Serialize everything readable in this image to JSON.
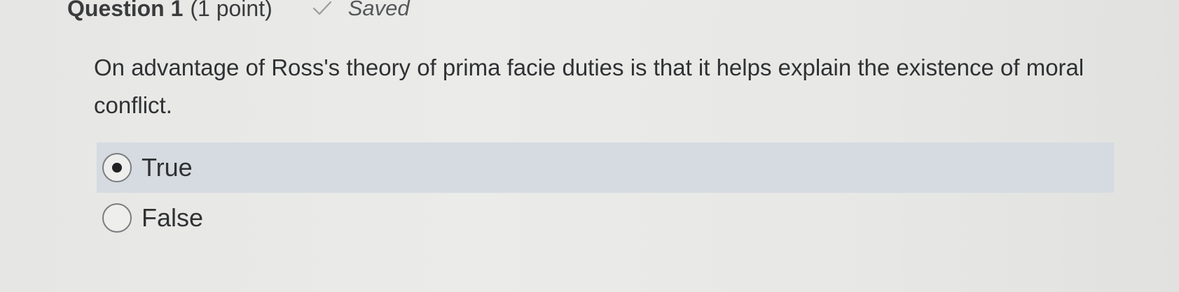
{
  "question": {
    "title": "Question 1",
    "points": "(1 point)",
    "status": "Saved",
    "status_icon": "check-icon",
    "text": "On advantage of Ross's theory of prima facie duties is that it helps explain the existence of moral conflict."
  },
  "options": [
    {
      "label": "True",
      "selected": true
    },
    {
      "label": "False",
      "selected": false
    }
  ],
  "colors": {
    "selected_row": "#d5dbe0",
    "background": "#e8e8e6",
    "text": "#2f3133"
  }
}
